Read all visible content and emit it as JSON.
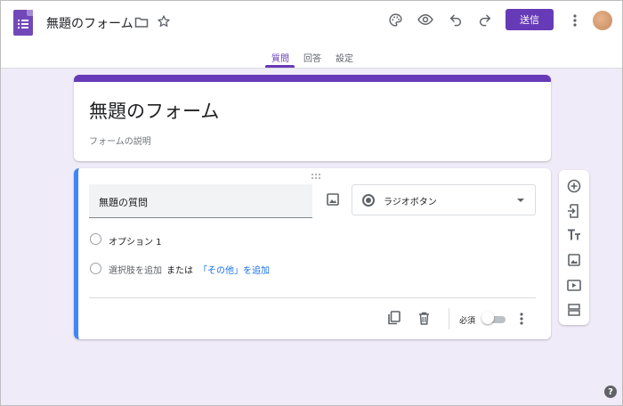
{
  "header": {
    "title": "無題のフォーム",
    "send_label": "送信"
  },
  "tabs": [
    {
      "label": "質問",
      "active": true
    },
    {
      "label": "回答",
      "active": false
    },
    {
      "label": "設定",
      "active": false
    }
  ],
  "form": {
    "title": "無題のフォーム",
    "description_placeholder": "フォームの説明"
  },
  "question": {
    "title": "無題の質問",
    "type_label": "ラジオボタン",
    "options": [
      "オプション 1"
    ],
    "add_option_label": "選択肢を追加",
    "or_label": "または",
    "add_other_label": "「その他」を追加",
    "required_label": "必須",
    "required_on": false
  },
  "colors": {
    "accent": "#673ab7",
    "background": "#f0ebf8",
    "question_border": "#4285f4",
    "link": "#1a73e8"
  },
  "icons": {
    "header": [
      "folder-icon",
      "star-icon",
      "palette-icon",
      "eye-icon",
      "undo-icon",
      "redo-icon",
      "more-vert-icon"
    ],
    "side_toolbar": [
      "add-question-icon",
      "import-questions-icon",
      "add-title-icon",
      "add-image-icon",
      "add-video-icon",
      "add-section-icon"
    ],
    "question_footer": [
      "duplicate-icon",
      "delete-icon",
      "more-vert-icon"
    ]
  }
}
